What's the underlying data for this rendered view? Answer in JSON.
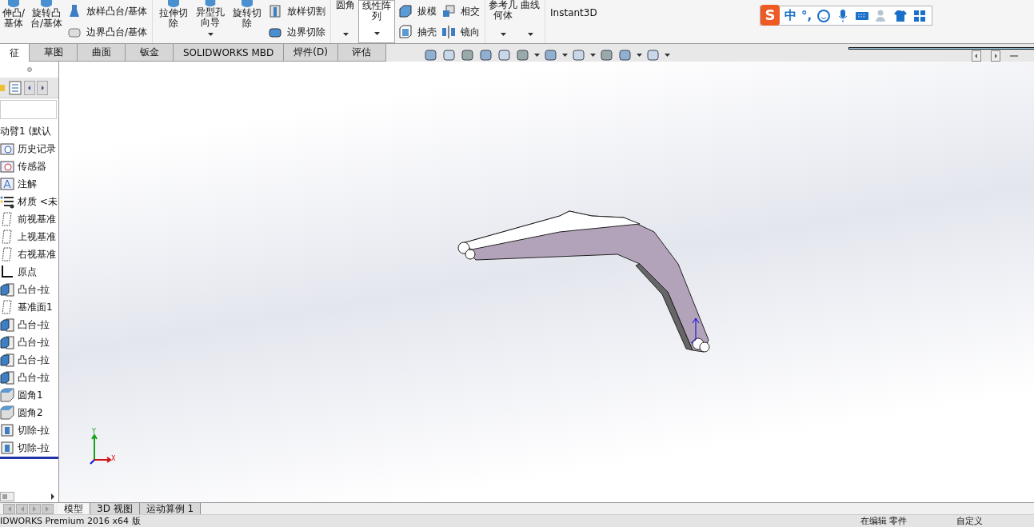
{
  "ribbon": {
    "big_buttons": [
      {
        "label": "伸凸/基体"
      },
      {
        "label": "旋转凸台/基体"
      }
    ],
    "small_columns": [
      [
        {
          "label": "放样凸台/基体",
          "kind": "loft"
        },
        {
          "label": "边界凸台/基体",
          "kind": "boundary"
        }
      ]
    ],
    "cut_buttons": [
      {
        "label": "拉伸切除",
        "caret": false
      },
      {
        "label": "异型孔向导",
        "caret": true
      },
      {
        "label": "旋转切除",
        "caret": false
      }
    ],
    "cut_small": [
      {
        "label": "放样切割",
        "kind": "loftcut"
      },
      {
        "label": "边界切除",
        "kind": "boundarycut"
      }
    ],
    "feature_buttons": [
      {
        "label": "圆角",
        "caret": true,
        "boxed": false
      },
      {
        "label": "线性阵列",
        "caret": true,
        "boxed": true
      }
    ],
    "feature_small": [
      [
        {
          "label": "拔模",
          "kind": "draft"
        },
        {
          "label": "抽壳",
          "kind": "shell"
        }
      ],
      [
        {
          "label": "相交",
          "kind": "intersect"
        },
        {
          "label": "镜向",
          "kind": "mirror"
        }
      ]
    ],
    "ref_buttons": [
      {
        "label": "参考几何体",
        "caret": true
      },
      {
        "label": "曲线",
        "caret": true
      }
    ],
    "instant": {
      "label": "Instant3D"
    }
  },
  "ime": {
    "logo": "S",
    "mode": "中",
    "punct": "°,"
  },
  "tabs": [
    {
      "label": "征",
      "selected": true
    },
    {
      "label": "草图",
      "selected": false
    },
    {
      "label": "曲面",
      "selected": false
    },
    {
      "label": "钣金",
      "selected": false
    },
    {
      "label": "SOLIDWORKS MBD",
      "selected": false
    },
    {
      "label": "焊件(D)",
      "selected": false
    },
    {
      "label": "评估",
      "selected": false
    }
  ],
  "tree": {
    "root": "动臂1 (默认",
    "items": [
      {
        "label": "历史记录",
        "kind": "history"
      },
      {
        "label": "传感器",
        "kind": "sensor"
      },
      {
        "label": "注解",
        "kind": "annotation"
      },
      {
        "label": "材质 <未",
        "kind": "material"
      },
      {
        "label": "前视基准",
        "kind": "plane"
      },
      {
        "label": "上视基准",
        "kind": "plane"
      },
      {
        "label": "右视基准",
        "kind": "plane"
      },
      {
        "label": "原点",
        "kind": "origin"
      },
      {
        "label": "凸台-拉",
        "kind": "boss"
      },
      {
        "label": "基准面1",
        "kind": "plane"
      },
      {
        "label": "凸台-拉",
        "kind": "boss"
      },
      {
        "label": "凸台-拉",
        "kind": "boss"
      },
      {
        "label": "凸台-拉",
        "kind": "boss"
      },
      {
        "label": "凸台-拉",
        "kind": "boss"
      },
      {
        "label": "圆角1",
        "kind": "fillet"
      },
      {
        "label": "圆角2",
        "kind": "fillet"
      },
      {
        "label": "切除-拉",
        "kind": "cut"
      },
      {
        "label": "切除-拉",
        "kind": "cut"
      }
    ]
  },
  "triad": {
    "y": "Y",
    "x": "X"
  },
  "bottom_tabs": [
    {
      "label": "模型",
      "selected": true
    },
    {
      "label": "3D 视图",
      "selected": false
    },
    {
      "label": "运动算例 1",
      "selected": false
    }
  ],
  "status_bar": {
    "app": "IDWORKS Premium 2016 x64 版",
    "mode": "在编辑 零件",
    "custom": "自定义"
  }
}
